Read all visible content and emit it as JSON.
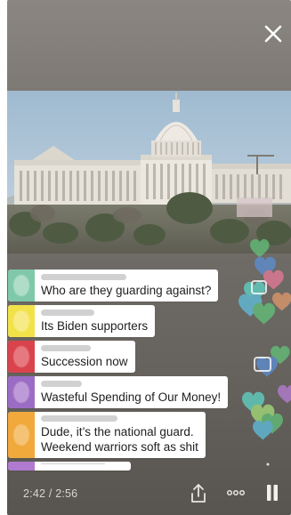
{
  "player": {
    "time_elapsed": "2:42",
    "time_separator": "/",
    "time_total": "2:56",
    "progress_fraction": 0.94,
    "close_icon": "close-icon",
    "share_icon": "share-icon",
    "more_icon": "more-dots-icon",
    "pause_icon": "pause-icon"
  },
  "comments": [
    {
      "text": "Who are they guarding against?",
      "avatar_color": "#7fc8a9"
    },
    {
      "text": "Its Biden supporters",
      "avatar_color": "#f2e24a"
    },
    {
      "text": "Succession now",
      "avatar_color": "#d9434c"
    },
    {
      "text": "Wasteful Spending of Our Money!",
      "avatar_color": "#9b6cc4"
    },
    {
      "text_line1": "Dude, it’s the national guard.",
      "text_line2": "Weekend warriors soft as shit",
      "avatar_color": "#f0a93a"
    },
    {
      "text": "",
      "avatar_color": "#b07ad0"
    }
  ],
  "colors": {
    "background": "#6a6762",
    "sky": "#a9c3d8",
    "capitol": "#e8e4dc",
    "heart_blue": "#5b8fd6",
    "heart_green": "#62c27a",
    "heart_teal": "#5fd6c9",
    "heart_pink": "#e87a9a",
    "heart_purple": "#b77ed8"
  }
}
